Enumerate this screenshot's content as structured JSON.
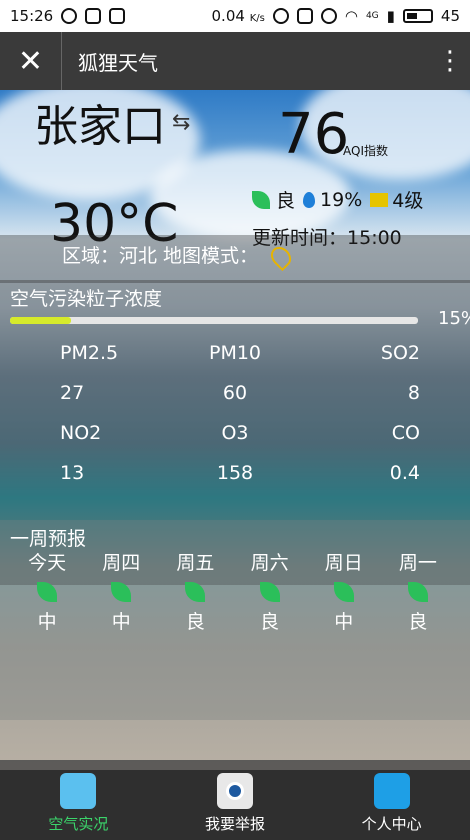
{
  "status": {
    "time": "15:26",
    "speed": "0.04",
    "speed_unit": "K/s",
    "net": "4G",
    "battery": "45"
  },
  "header": {
    "title": "狐狸天气"
  },
  "weather": {
    "city": "张家口",
    "aqi": "76",
    "aqi_label": "AQI指数",
    "temperature": "30°C",
    "quality": "良",
    "humidity": "19%",
    "wind": "4级",
    "update_label": "更新时间：",
    "update_time": "15:00",
    "region_text": "区域：河北 地图模式：",
    "accent_green": "#2bbf5a"
  },
  "pollution": {
    "title": "空气污染粒子浓度",
    "percent": "15%",
    "percent_value": 15,
    "items": [
      {
        "label": "PM2.5",
        "value": "27"
      },
      {
        "label": "PM10",
        "value": "60"
      },
      {
        "label": "SO2",
        "value": "8"
      },
      {
        "label": "NO2",
        "value": "13"
      },
      {
        "label": "O3",
        "value": "158"
      },
      {
        "label": "CO",
        "value": "0.4"
      }
    ],
    "bar_color": "#d6ea2b"
  },
  "week": {
    "title": "一周预报",
    "days": [
      {
        "name": "今天",
        "aqi": "中"
      },
      {
        "name": "周四",
        "aqi": "中"
      },
      {
        "name": "周五",
        "aqi": "良"
      },
      {
        "name": "周六",
        "aqi": "良"
      },
      {
        "name": "周日",
        "aqi": "中"
      },
      {
        "name": "周一",
        "aqi": "良"
      }
    ]
  },
  "nav": [
    {
      "label": "空气实况",
      "icon": "weather-icon",
      "active": true
    },
    {
      "label": "我要举报",
      "icon": "camera-icon",
      "active": false
    },
    {
      "label": "个人中心",
      "icon": "user-icon",
      "active": false
    }
  ]
}
